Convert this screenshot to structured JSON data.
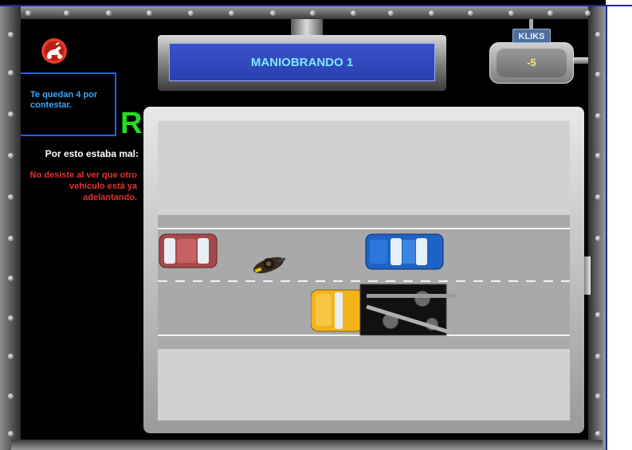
{
  "header": {
    "title": "MANIOBRANDO 1"
  },
  "score": {
    "label": "KLIKS",
    "value": "-5"
  },
  "progress": {
    "remaining_text": "Te quedan 4 por contestar.",
    "result_letter": "R"
  },
  "feedback": {
    "label": "Por esto estaba mal:",
    "explanation": "No desiste al ver que otro vehículo está ya adelantando."
  },
  "icons": {
    "logo": "moped-logo-icon",
    "status": "status-dot-icon"
  },
  "colors": {
    "title_text": "#7fe6ff",
    "title_plate": "#2840b2",
    "question_text": "#3aa8ff",
    "result_letter": "#22dd22",
    "explanation_text": "#e23232",
    "score_value": "#ffe680",
    "red_car": "#a54a4a",
    "blue_car": "#1e62c6",
    "tow_truck_cab": "#f2b31a"
  }
}
